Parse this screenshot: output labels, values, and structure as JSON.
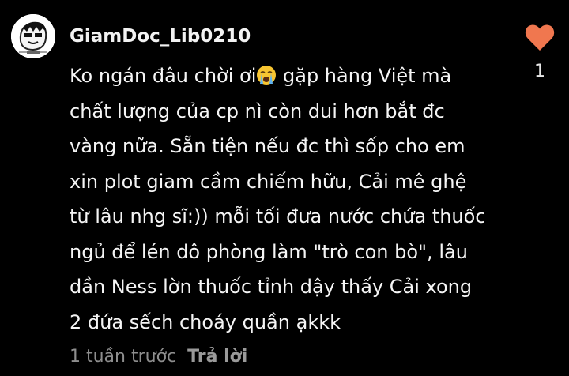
{
  "comment": {
    "username": "GiamDoc_Lib0210",
    "text_lines": [
      "Ko ngán đâu chời ơi",
      " gặp hàng Việt mà",
      "chất lượng của cp nì còn dui hơn bắt đc",
      "vàng nữa. Sẵn tiện nếu đc thì sốp cho em",
      "xin plot giam cầm chiếm hữu, Cải mê ghệ",
      "từ lâu nhg sĩ:)) mỗi tối đưa nước chứa thuốc",
      "ngủ để lén dô phòng làm \"trò con bò\", lâu",
      "dần Ness lờn thuốc tỉnh dậy thấy Cải xong",
      "2 đứa sếch choáy quần ạkkk"
    ],
    "emoji": "crying-face-emoji",
    "timestamp": "1 tuần trước",
    "reply_label": "Trả lời",
    "like_count": "1",
    "like_icon": "heart-icon",
    "like_color": "#f0774f"
  }
}
